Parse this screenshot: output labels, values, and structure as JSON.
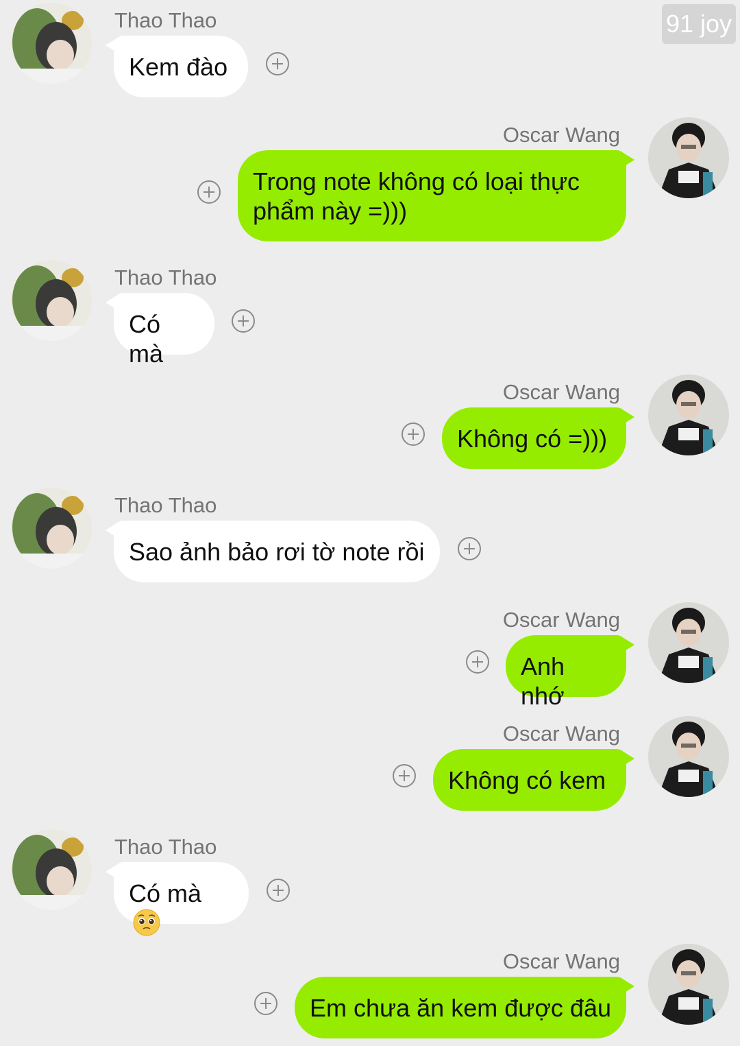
{
  "watermark": "91 joy",
  "colors": {
    "background": "#ededed",
    "incoming_bubble": "#ffffff",
    "outgoing_bubble": "#95ec00",
    "name_text": "#747474"
  },
  "messages": [
    {
      "sender": "Thao Thao",
      "direction": "incoming",
      "text": "Kem đào"
    },
    {
      "sender": "Oscar Wang",
      "direction": "outgoing",
      "text": "Trong note không có loại thực phẩm này =)))"
    },
    {
      "sender": "Thao Thao",
      "direction": "incoming",
      "text": "Có mà"
    },
    {
      "sender": "Oscar Wang",
      "direction": "outgoing",
      "text": "Không có =)))"
    },
    {
      "sender": "Thao Thao",
      "direction": "incoming",
      "text": "Sao ảnh bảo rơi tờ note rồi"
    },
    {
      "sender": "Oscar Wang",
      "direction": "outgoing",
      "text": "Anh nhớ"
    },
    {
      "sender": "Oscar Wang",
      "direction": "outgoing",
      "text": "Không có kem"
    },
    {
      "sender": "Thao Thao",
      "direction": "incoming",
      "text": "Có mà",
      "emoji": "pleading-face-emoji"
    },
    {
      "sender": "Oscar Wang",
      "direction": "outgoing",
      "text": "Em chưa ăn kem được đâu"
    }
  ]
}
